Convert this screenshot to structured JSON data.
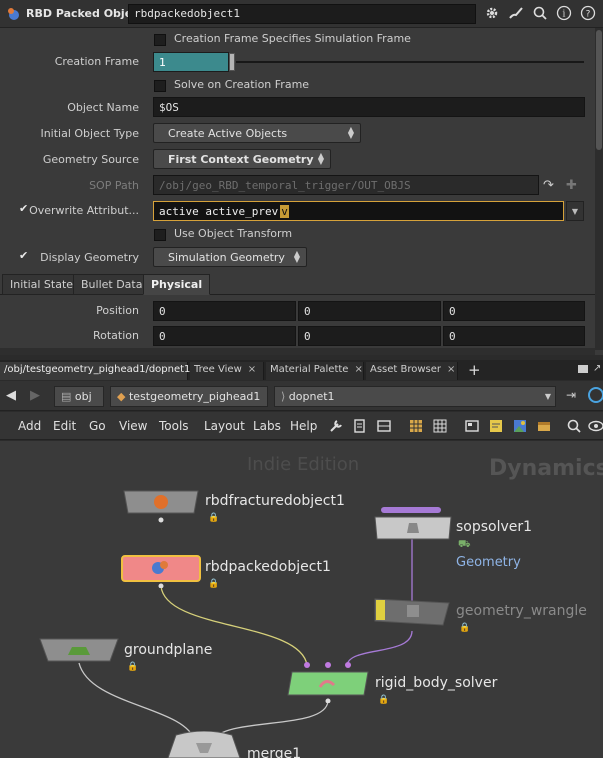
{
  "param_header": {
    "node_type": "RBD Packed Object",
    "node_name": "rbdpackedobject1"
  },
  "params": {
    "creation_frame_specifies": "Creation Frame Specifies Simulation Frame",
    "creation_frame_label": "Creation Frame",
    "creation_frame_value": "1",
    "solve_on_creation": "Solve on Creation Frame",
    "object_name_label": "Object Name",
    "object_name_value": "$OS",
    "initial_object_type_label": "Initial Object Type",
    "initial_object_type_value": "Create Active Objects",
    "geometry_source_label": "Geometry Source",
    "geometry_source_value": "First Context Geometry",
    "sop_path_label": "SOP Path",
    "sop_path_value": "/obj/geo_RBD_temporal_trigger/OUT_OBJS",
    "overwrite_label": "Overwrite Attribut...",
    "overwrite_value": "active active_prev",
    "overwrite_caret": "v",
    "use_object_transform": "Use Object Transform",
    "display_geometry_label": "Display Geometry",
    "display_geometry_value": "Simulation Geometry"
  },
  "param_tabs": [
    "Initial State",
    "Bullet Data",
    "Physical"
  ],
  "vector_rows": [
    {
      "label": "Position",
      "values": [
        "0",
        "0",
        "0"
      ]
    },
    {
      "label": "Rotation",
      "values": [
        "0",
        "0",
        "0"
      ]
    }
  ],
  "pane_tabs": [
    {
      "label": "/obj/testgeometry_pighead1/dopnet1"
    },
    {
      "label": "Tree View"
    },
    {
      "label": "Material Palette"
    },
    {
      "label": "Asset Browser"
    }
  ],
  "path": {
    "obj": "obj",
    "geo": "testgeometry_pighead1",
    "dop": "dopnet1"
  },
  "menu": [
    "Add",
    "Edit",
    "Go",
    "View",
    "Tools",
    "Layout",
    "Labs",
    "Help"
  ],
  "network": {
    "watermark": "Indie Edition",
    "context": "Dynamics",
    "nodes": {
      "rbdfractured": "rbdfracturedobject1",
      "rbdpacked": "rbdpackedobject1",
      "sopsolver": "sopsolver1",
      "sopsolver_sub": "Geometry",
      "wrangle": "geometry_wrangle",
      "groundplane": "groundplane",
      "solver": "rigid_body_solver",
      "merge": "merge1"
    }
  },
  "colors": {
    "solver": "#7ed07a",
    "packed": "#f08888",
    "selected_outline": "#f0c040",
    "sopsolver_bar": "#a67ad6"
  }
}
